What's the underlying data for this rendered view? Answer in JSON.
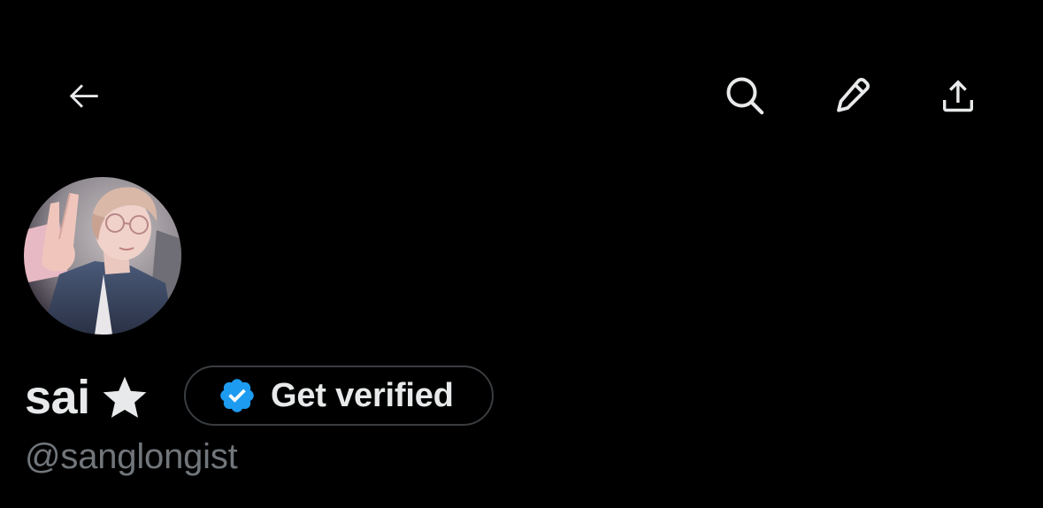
{
  "header": {
    "back_icon": "arrow-left-icon",
    "search_icon": "search-icon",
    "edit_icon": "pencil-icon",
    "share_icon": "share-upload-icon"
  },
  "profile": {
    "display_name": "sai",
    "name_emoji": "★",
    "handle": "@sanglongist",
    "avatar_alt": "avatar"
  },
  "get_verified": {
    "label": "Get verified",
    "icon": "verified-badge-icon",
    "badge_color": "#1d9bf0"
  },
  "colors": {
    "background": "#000000",
    "text_primary": "#e7e9ea",
    "text_secondary": "#71767b",
    "border": "#3a3d40",
    "accent": "#1d9bf0"
  }
}
